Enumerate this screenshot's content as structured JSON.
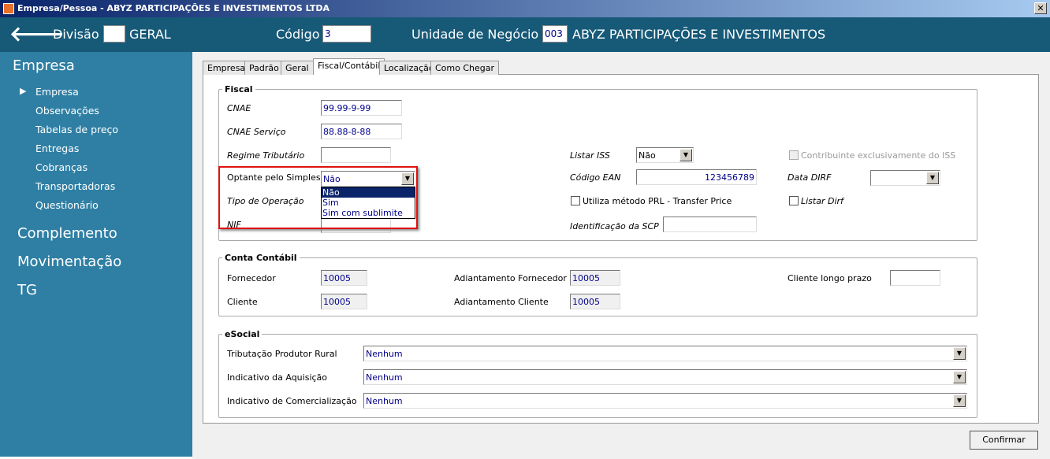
{
  "window": {
    "title": "Empresa/Pessoa - ABYZ PARTICIPAÇÕES E INVESTIMENTOS LTDA",
    "close": "✕"
  },
  "header": {
    "back": "🡐",
    "divisao_label": "Divisão",
    "divisao_value": "",
    "divisao_name": "GERAL",
    "codigo_label": "Código",
    "codigo_value": "3",
    "unidade_label": "Unidade de Negócio",
    "unidade_code": "003",
    "unidade_name": "ABYZ PARTICIPAÇÕES E INVESTIMENTOS"
  },
  "sidebar": {
    "section": "Empresa",
    "items": [
      "Empresa",
      "Observações",
      "Tabelas de preço",
      "Entregas",
      "Cobranças",
      "Transportadoras",
      "Questionário"
    ],
    "arrow": "▶",
    "sections2": [
      "Complemento",
      "Movimentação",
      "TG"
    ]
  },
  "tabs": [
    "Empresa",
    "Padrão",
    "Geral",
    "Fiscal/Contábil",
    "Localização",
    "Como Chegar"
  ],
  "fiscal": {
    "title": "Fiscal",
    "cnae_label": "CNAE",
    "cnae": "99.99-9-99",
    "cnae_serv_label": "CNAE Serviço",
    "cnae_serv": "88.88-8-88",
    "regime_label": "Regime Tributário",
    "regime": "",
    "optante_label": "Optante pelo Simples",
    "optante": "Não",
    "optante_options": [
      "Não",
      "Sim",
      "Sim com sublimite"
    ],
    "tipo_op_label": "Tipo de Operação",
    "nif_label": "NIF",
    "listar_iss_label": "Listar  ISS",
    "listar_iss": "Não",
    "ean_label": "Código EAN",
    "ean": "123456789",
    "prl_label": "Utiliza método PRL - Transfer Price",
    "scp_label": "Identificação da SCP",
    "scp": "",
    "contrib_label": "Contribuinte exclusivamente do ISS",
    "dirf_label": "Data DIRF",
    "dirf": "",
    "listar_dirf_label": "Listar Dirf"
  },
  "conta": {
    "title": "Conta Contábil",
    "fornecedor_label": "Fornecedor",
    "fornecedor": "10005",
    "cliente_label": "Cliente",
    "cliente": "10005",
    "adi_forn_label": "Adiantamento Fornecedor",
    "adi_forn": "10005",
    "adi_cli_label": "Adiantamento Cliente",
    "adi_cli": "10005",
    "longo_label": "Cliente longo prazo",
    "longo": ""
  },
  "esocial": {
    "title": "eSocial",
    "trib_label": "Tributação Produtor Rural",
    "trib": "Nenhum",
    "aquis_label": "Indicativo da Aquisição",
    "aquis": "Nenhum",
    "comerc_label": "Indicativo de Comercialização",
    "comerc": "Nenhum"
  },
  "confirm": "Confirmar"
}
